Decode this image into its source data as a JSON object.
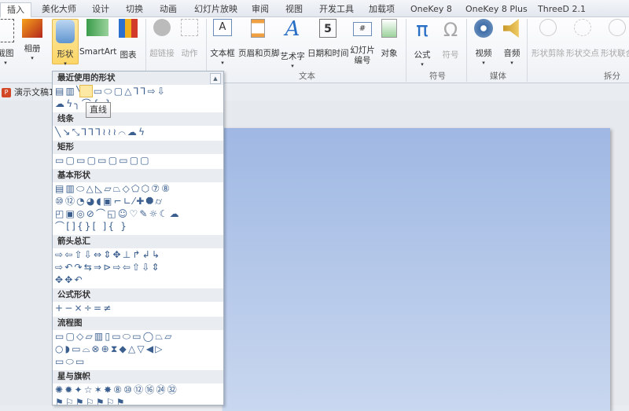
{
  "tabs": [
    "插入",
    "美化大师",
    "设计",
    "切换",
    "动画",
    "幻灯片放映",
    "审阅",
    "视图",
    "开发工具",
    "加载项",
    "OneKey 8",
    "OneKey 8 Plus",
    "ThreeD 2.1"
  ],
  "ribbon": {
    "buttons": [
      "截图",
      "相册",
      "形状",
      "SmartArt",
      "图表",
      "超链接",
      "动作",
      "文本框",
      "页眉和页脚",
      "艺术字",
      "日期和时间",
      "幻灯片\n编号",
      "对象",
      "公式",
      "符号",
      "视频",
      "音频",
      "形状剪除",
      "形状交点",
      "形状联合"
    ],
    "groups": [
      "文本",
      "符号",
      "媒体",
      "拆分"
    ]
  },
  "document_tab": "演示文稿1",
  "gallery": {
    "sections": [
      {
        "title": "最近使用的形状",
        "rows": [
          "▤▥╲↘▭⬭▢△⅂⅂⇨⇩",
          "☁ϟ╮⌒{ }"
        ]
      },
      {
        "title": "线条",
        "rows": [
          "╲↘⤡⅂⅂⅂≀≀≀⌒☁ϟ"
        ]
      },
      {
        "title": "矩形",
        "rows": [
          "▭▢▭▢▭▢▭▢▢"
        ]
      },
      {
        "title": "基本形状",
        "rows": [
          "▤▥⬭△◺▱⏢◇⬠⬡⑦⑧",
          "⑩⑫◔◕◖▣⌐∟⁄✚⯃⌭",
          "◰▣◎⊘⌒◱☺♡✎☼☾☁",
          "⌒[]{}[ ]{ }"
        ]
      },
      {
        "title": "箭头总汇",
        "rows": [
          "⇨⇦⇧⇩⇔⇕✥⊥↱↲↳",
          "⇨↶↷⇆⇒⊳⇨⇦⇧⇩⇕",
          "✥✥↶"
        ]
      },
      {
        "title": "公式形状",
        "rows": [
          "+−×÷=≠"
        ]
      },
      {
        "title": "流程图",
        "rows": [
          "▭▢◇▱▥▯▭⬭▭◯⏢⏥",
          "○◗▭⌓⊗⊕⧗◆△▽◀▷",
          "▭⬭▭"
        ]
      },
      {
        "title": "星与旗帜",
        "rows": [
          "✺✹✦☆✶✸⑧⑩⑫⑯㉔㉜",
          "⚑⚐⚑⚐⚑⚐⚑"
        ]
      }
    ],
    "tooltip": "直线"
  }
}
